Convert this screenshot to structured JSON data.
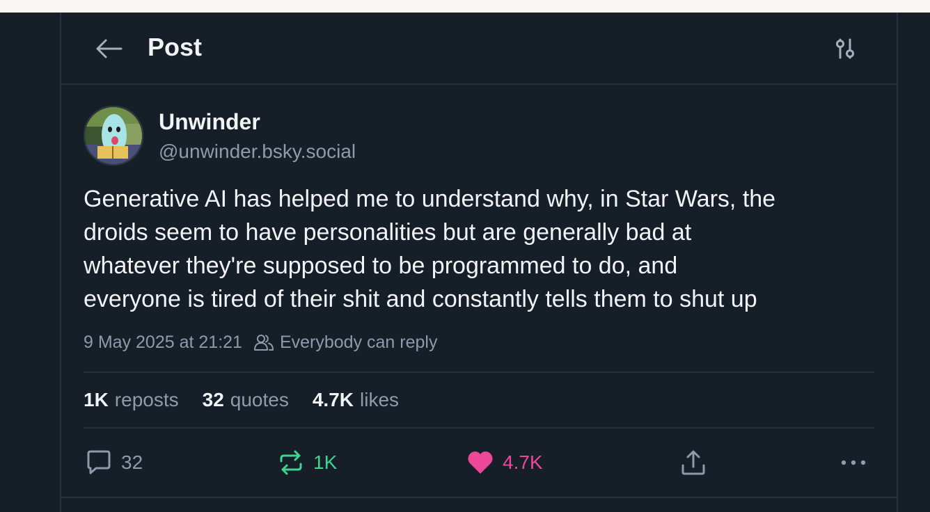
{
  "header": {
    "title": "Post",
    "back_icon": "arrow-left-icon",
    "settings_icon": "sliders-icon"
  },
  "author": {
    "display_name": "Unwinder",
    "handle": "@unwinder.bsky.social"
  },
  "post": {
    "text": "Generative AI has helped me to understand why, in Star Wars, the\ndroids seem to have personalities but are generally bad at\nwhatever they're supposed to be programmed to do, and\neveryone is tired of their shit and constantly tells them to shut up",
    "timestamp": "9 May 2025 at 21:21",
    "reply_setting": "Everybody can reply"
  },
  "stats": {
    "reposts": {
      "count": "1K",
      "label": "reposts"
    },
    "quotes": {
      "count": "32",
      "label": "quotes"
    },
    "likes": {
      "count": "4.7K",
      "label": "likes"
    }
  },
  "actions": {
    "reply": "32",
    "repost": "1K",
    "like": "4.7K"
  },
  "colors": {
    "background": "#161e27",
    "border": "#26313e",
    "text_primary": "#f1f3f5",
    "text_secondary": "#8d9bab",
    "repost_green": "#3fd48f",
    "like_pink": "#ec4899"
  }
}
